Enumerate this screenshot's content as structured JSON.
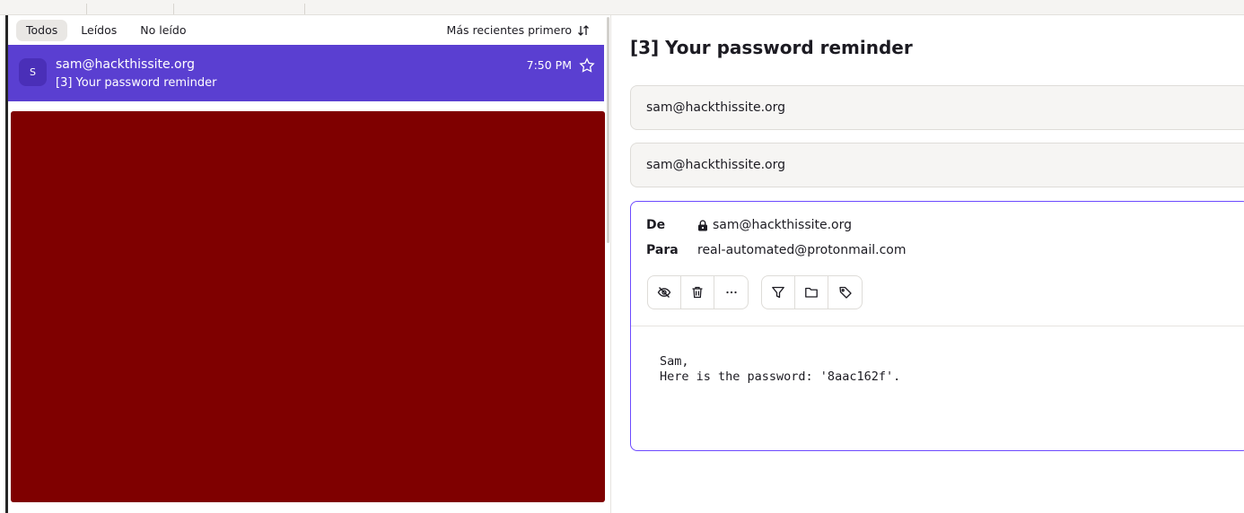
{
  "filters": {
    "all": "Todos",
    "read": "Leídos",
    "unread": "No leído"
  },
  "sort": {
    "label": "Más recientes primero",
    "icon": "sort-icon"
  },
  "message_list": [
    {
      "avatar": "S",
      "sender": "sam@hackthissite.org",
      "subject": "[3] Your password reminder",
      "time": "7:50 PM",
      "icon": "star-icon"
    }
  ],
  "reader": {
    "title": "[3] Your password reminder",
    "collapsed_messages": [
      {
        "sender": "sam@hackthissite.org"
      },
      {
        "sender": "sam@hackthissite.org"
      }
    ],
    "expanded": {
      "from_label": "De",
      "from": "sam@hackthissite.org",
      "to_label": "Para",
      "to": "real-automated@protonmail.com",
      "body_line1": "Sam,",
      "body_line2": "Here is the password: '8aac162f'."
    },
    "toolbar_icons": [
      "eye-off-icon",
      "trash-icon",
      "more-icon",
      "filter-icon",
      "folder-icon",
      "tag-icon"
    ]
  },
  "colors": {
    "accent": "#5a3fd1",
    "selection_border": "#6d4aff",
    "red_block": "#7f0000"
  }
}
